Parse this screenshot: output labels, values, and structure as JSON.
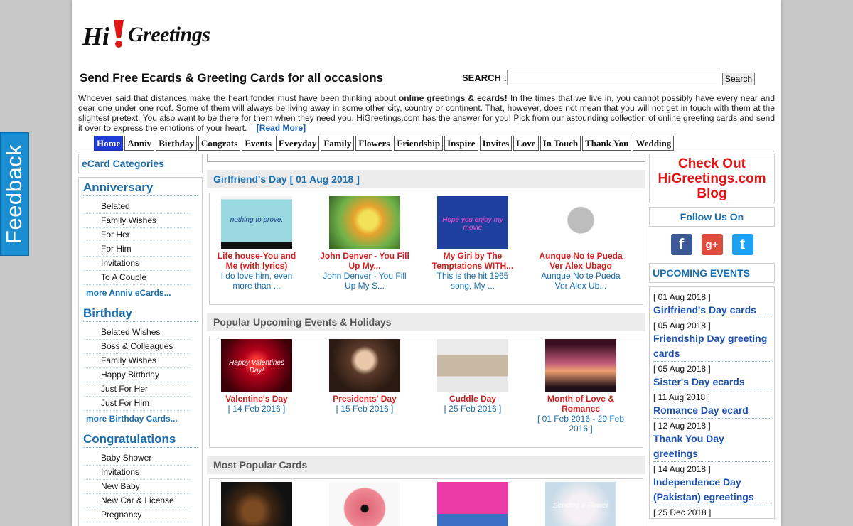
{
  "feedback": {
    "label": "Feedback"
  },
  "header": {
    "logo": {
      "hi": "Hi",
      "greetings": "Greetings"
    },
    "tagline": "Send Free Ecards & Greeting Cards for all occasions",
    "search": {
      "label": "SEARCH :",
      "placeholder": "",
      "value": "",
      "button": "Search"
    }
  },
  "intro": {
    "text_before": "Whoever said that distances make the heart fonder must have been thinking about ",
    "bold": "online greetings & ecards!",
    "text_after": " In the times that we live in, you cannot possibly have every near and dear one under one roof. Some of them will always be living away in some other city, country or continent. That, however, does not mean that you will not get in touch with them at the slightest pretext. You also want to be there for them when they need you. HiGreetings.com has the answer for you! Pick from our astounding collection of online greeting cards and send it over to express the emotions of your heart.",
    "read_more": "[Read More]"
  },
  "nav": {
    "tabs": [
      "Home",
      "Anniv",
      "Birthday",
      "Congrats",
      "Events",
      "Everyday",
      "Family",
      "Flowers",
      "Friendship",
      "Inspire",
      "Invites",
      "Love",
      "In Touch",
      "Thank You",
      "Wedding"
    ]
  },
  "sidebar": {
    "heading": "eCard Categories",
    "categories": [
      {
        "title": "Anniversary",
        "items": [
          "Belated",
          "Family Wishes",
          "For Her",
          "For Him",
          "Invitations",
          "To A Couple"
        ],
        "more": "more Anniv eCards..."
      },
      {
        "title": "Birthday",
        "items": [
          "Belated Wishes",
          "Boss & Colleagues",
          "Family Wishes",
          "Happy Birthday",
          "Just For Her",
          "Just For Him"
        ],
        "more": "more Birthday Cards..."
      },
      {
        "title": "Congratulations",
        "items": [
          "Baby Shower",
          "Invitations",
          "New Baby",
          "New Car & License",
          "Pregnancy"
        ]
      }
    ]
  },
  "sections": [
    {
      "title": "Girlfriend's Day [ 01 Aug 2018 ]",
      "cards": [
        {
          "title": "Life house-You and Me (with lyrics)",
          "desc": "I do love him, even more than ...",
          "thumb_text": "nothing to prove."
        },
        {
          "title": "John Denver - You Fill Up My...",
          "desc": "John Denver - You Fill Up My S..."
        },
        {
          "title": "My Girl by The Temptations WITH...",
          "desc": "This is the hit 1965 song, My ...",
          "thumb_text": "Hope you enjoy my movie"
        },
        {
          "title": "Aunque No te Pueda Ver Alex Ubago",
          "desc": "Aunque No te Pueda Ver Alex Ub..."
        }
      ]
    },
    {
      "title": "Popular Upcoming Events & Holidays",
      "cards": [
        {
          "title": "Valentine's Day",
          "desc": "[ 14 Feb 2016 ]",
          "thumb_text": "Happy Valentines Day!"
        },
        {
          "title": "Presidents' Day",
          "desc": "[ 15 Feb 2016 ]"
        },
        {
          "title": "Cuddle Day",
          "desc": "[ 25 Feb 2016 ]"
        },
        {
          "title": "Month of Love & Romance",
          "desc": "[ 01 Feb 2016 - 29 Feb 2016 ]"
        }
      ]
    },
    {
      "title": "Most Popular Cards",
      "cards": [
        {
          "title": "",
          "desc": ""
        },
        {
          "title": "",
          "desc": ""
        },
        {
          "title": "",
          "desc": ""
        },
        {
          "title": "",
          "desc": "",
          "thumb_text": "Sending a Flower"
        }
      ]
    }
  ],
  "right": {
    "blog": [
      "Check Out",
      "HiGreetings.com",
      "Blog"
    ],
    "follow": "Follow Us On",
    "social": [
      {
        "icon": "facebook-icon",
        "glyph": "f",
        "color": "#3b5998"
      },
      {
        "icon": "google-plus-icon",
        "glyph": "g+",
        "color": "#dd4b39"
      },
      {
        "icon": "twitter-icon",
        "glyph": "t",
        "color": "#1da1f2"
      }
    ],
    "upcoming_heading": "UPCOMING EVENTS",
    "events": [
      {
        "date": "[ 01 Aug 2018 ]",
        "name": "Girlfriend's Day cards"
      },
      {
        "date": "[ 05 Aug 2018 ]",
        "name": "Friendship Day greeting cards"
      },
      {
        "date": "[ 05 Aug 2018 ]",
        "name": "Sister's Day ecards"
      },
      {
        "date": "[ 11 Aug 2018 ]",
        "name": "Romance Day ecard"
      },
      {
        "date": "[ 12 Aug 2018 ]",
        "name": "Thank You Day greetings"
      },
      {
        "date": "[ 14 Aug 2018 ]",
        "name": "Independence Day (Pakistan) egreetings"
      },
      {
        "date": "[ 25 Dec 2018 ]",
        "name": ""
      }
    ]
  }
}
